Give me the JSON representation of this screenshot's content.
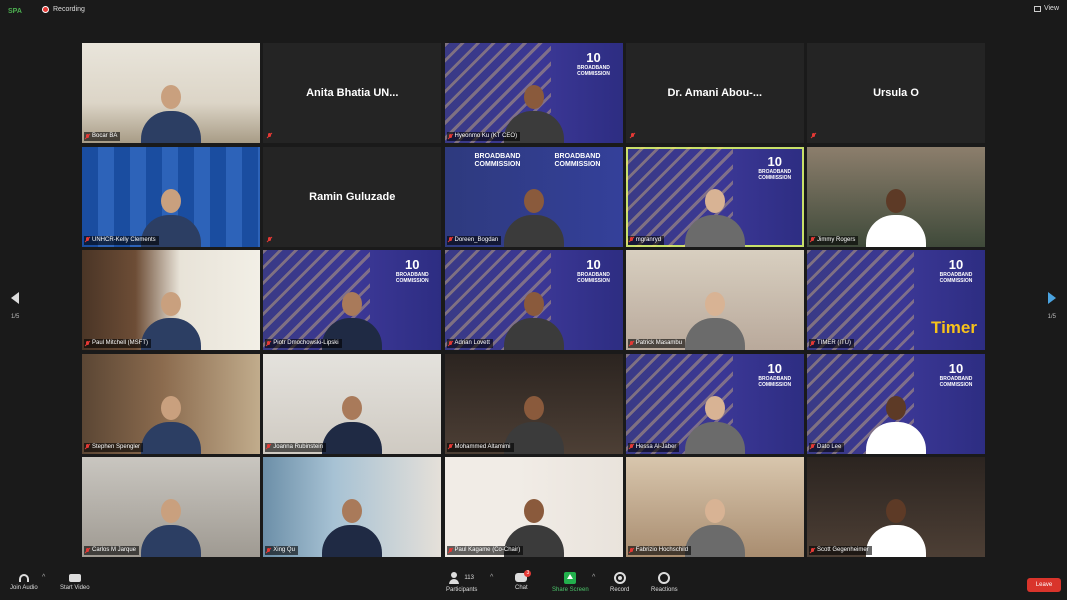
{
  "top": {
    "app_logo": "SPA",
    "recording": "Recording",
    "view": "View"
  },
  "nav": {
    "page_left": "1/5",
    "page_right": "1/5"
  },
  "tiles": [
    {
      "name": "Bocar BA",
      "type": "video",
      "bg": "bg-office"
    },
    {
      "name": "Anita Bhatia UN...",
      "type": "name"
    },
    {
      "name": "Hyeonmo Ku (KT CEO)",
      "type": "video",
      "bg": "bg-bbc"
    },
    {
      "name": "Dr. Amani Abou-...",
      "type": "name"
    },
    {
      "name": "Ursula O",
      "type": "name"
    },
    {
      "name": "UNHCR-Kelly Clements",
      "type": "video",
      "bg": "bg-unhcr"
    },
    {
      "name": "Ramin Guluzade",
      "type": "name"
    },
    {
      "name": "Doreen_Bogdan",
      "type": "video",
      "bg": "bg-bbc2"
    },
    {
      "name": "mgranryd",
      "type": "video",
      "bg": "bg-bbc",
      "active": true
    },
    {
      "name": "Jimmy Rogers",
      "type": "video",
      "bg": "bg-green"
    },
    {
      "name": "Paul Mitchell (MSFT)",
      "type": "video",
      "bg": "bg-bookshelf"
    },
    {
      "name": "Piotr Dmochowski-Lipski",
      "type": "video",
      "bg": "bg-bbc"
    },
    {
      "name": "Adrian Lovett",
      "type": "video",
      "bg": "bg-bbc"
    },
    {
      "name": "Patrick Masambu",
      "type": "video",
      "bg": "bg-living"
    },
    {
      "name": "TIMER (ITU)",
      "type": "timer",
      "bg": "bg-bbc",
      "label": "Timer"
    },
    {
      "name": "Stephen Spengler",
      "type": "video",
      "bg": "bg-library"
    },
    {
      "name": "Joanna Rubinstein",
      "type": "video",
      "bg": "bg-light"
    },
    {
      "name": "Mohammed Altamimi",
      "type": "video",
      "bg": "bg-dark"
    },
    {
      "name": "Hessa Al-Jaber",
      "type": "video",
      "bg": "bg-bbc"
    },
    {
      "name": "Dato Lee",
      "type": "video",
      "bg": "bg-bbc"
    },
    {
      "name": "Carlos M Jarque",
      "type": "video",
      "bg": "bg-gray"
    },
    {
      "name": "Xing Qu",
      "type": "video",
      "bg": "bg-flag"
    },
    {
      "name": "Paul Kagame (Co-Chair)",
      "type": "video",
      "bg": "bg-blue-flag"
    },
    {
      "name": "Fabrizio Hochschild",
      "type": "video",
      "bg": "bg-warm"
    },
    {
      "name": "Scott Gegenheimer",
      "type": "video",
      "bg": "bg-dark"
    }
  ],
  "bbc_logo": {
    "top": "BROADBAND",
    "mid": "COMMISSION",
    "ten": "10"
  },
  "bbc2_left": "BROADBAND COMMISSION",
  "bbc2_right": "BROADBAND COMMISSION",
  "toolbar": {
    "join_audio": "Join Audio",
    "start_video": "Start Video",
    "participants": "Participants",
    "participants_count": "113",
    "chat": "Chat",
    "chat_badge": "3",
    "share_screen": "Share Screen",
    "record": "Record",
    "reactions": "Reactions",
    "leave": "Leave"
  }
}
